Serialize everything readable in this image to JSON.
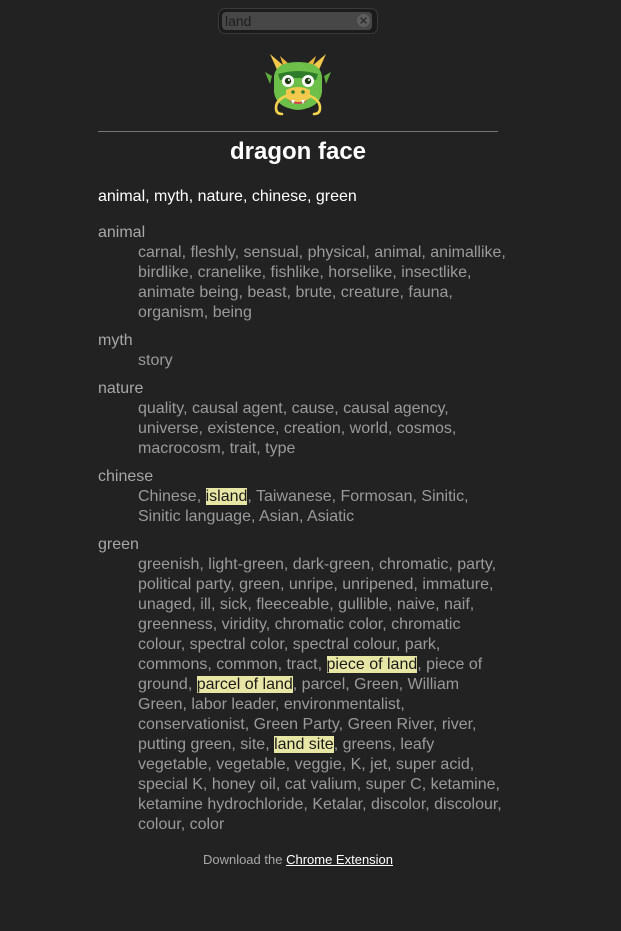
{
  "search": {
    "value": "land"
  },
  "emoji": {
    "icon": "dragon-face-icon",
    "colors": {
      "face": "#6cc04a",
      "face_dark": "#2f7d2a",
      "horn": "#f2c94c",
      "mouth": "#d64550",
      "whisker": "#f2d24c"
    }
  },
  "title": "dragon face",
  "keywords": "animal, myth, nature, chinese, green",
  "groups": [
    {
      "word": "animal",
      "synonyms": [
        {
          "text": "carnal, fleshly, sensual, physical, animal, animallike, birdlike, cranelike, fishlike, horselike, insectlike, animate being, beast, brute, creature, fauna, organism, being"
        }
      ]
    },
    {
      "word": "myth",
      "synonyms": [
        {
          "text": "story"
        }
      ]
    },
    {
      "word": "nature",
      "synonyms": [
        {
          "text": "quality, causal agent, cause, causal agency, universe, existence, creation, world, cosmos, macrocosm, trait, type"
        }
      ]
    },
    {
      "word": "chinese",
      "synonyms": [
        {
          "text": "Chinese, "
        },
        {
          "text": "island",
          "highlight": true
        },
        {
          "text": ", Taiwanese, Formosan, Sinitic, Sinitic language, Asian, Asiatic"
        }
      ]
    },
    {
      "word": "green",
      "synonyms": [
        {
          "text": "greenish, light-green, dark-green, chromatic, party, political party, green, unripe, unripened, immature, unaged, ill, sick, fleeceable, gullible, naive, naif, greenness, viridity, chromatic color, chromatic colour, spectral color, spectral colour, park, commons, common, tract, "
        },
        {
          "text": "piece of land",
          "highlight": true
        },
        {
          "text": ", piece of ground, "
        },
        {
          "text": "parcel of land",
          "highlight": true
        },
        {
          "text": ", parcel, Green, William Green, labor leader, environmentalist, conservationist, Green Party, Green River, river, putting green, site, "
        },
        {
          "text": "land site",
          "highlight": true
        },
        {
          "text": ", greens, leafy vegetable, vegetable, veggie, K, jet, super acid, special K, honey oil, cat valium, super C, ketamine, ketamine hydrochloride, Ketalar, discolor, discolour, colour, color"
        }
      ]
    }
  ],
  "footer": {
    "prefix": "Download the ",
    "link_label": "Chrome Extension"
  }
}
